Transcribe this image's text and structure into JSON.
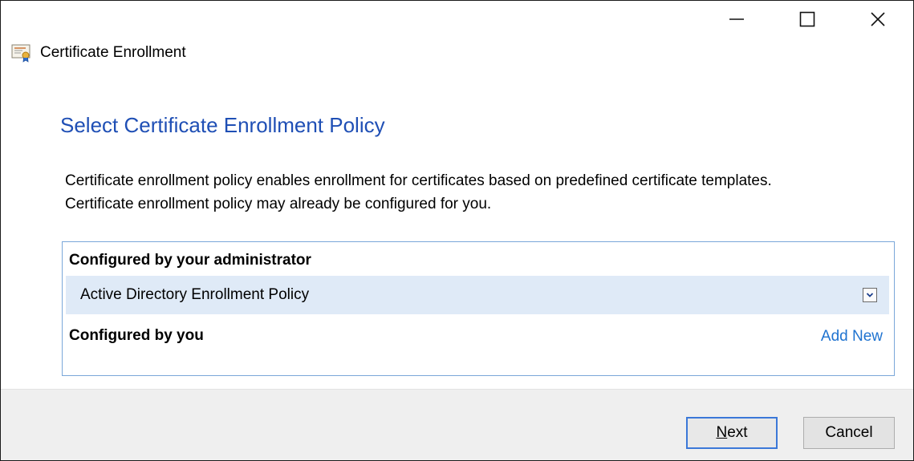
{
  "window": {
    "title": "Certificate Enrollment",
    "icon": "certificate-icon"
  },
  "caption_buttons": {
    "minimize_icon": "minimize-icon",
    "maximize_icon": "maximize-icon",
    "close_icon": "close-icon"
  },
  "page": {
    "heading": "Select Certificate Enrollment Policy",
    "description_line1": "Certificate enrollment policy enables enrollment for certificates based on predefined certificate templates.",
    "description_line2": "Certificate enrollment policy may already be configured for you."
  },
  "policies": {
    "admin_section_label": "Configured by your administrator",
    "admin_policy_name": "Active Directory Enrollment Policy",
    "user_section_label": "Configured by you",
    "add_new_label": "Add New"
  },
  "footer": {
    "next_mnemonic": "N",
    "next_rest": "ext",
    "cancel_label": "Cancel"
  },
  "colors": {
    "heading": "#1f4fb5",
    "link": "#1f73d0",
    "selected_row": "#dfeaf7",
    "box_border": "#7aa7d9"
  }
}
